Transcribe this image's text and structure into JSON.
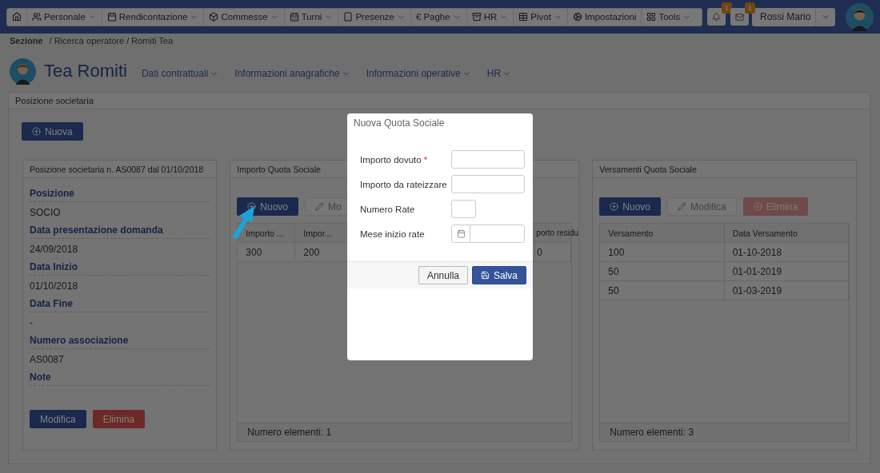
{
  "navbar": {
    "menu": [
      {
        "dropdown": false
      },
      {
        "label": "Personale",
        "dropdown": true
      },
      {
        "label": "Rendicontazione",
        "dropdown": true
      },
      {
        "label": "Commesse",
        "dropdown": true
      },
      {
        "label": "Turni",
        "dropdown": true
      },
      {
        "label": "Presenze",
        "dropdown": true
      },
      {
        "label": "Paghe",
        "symbol": "€",
        "dropdown": true
      },
      {
        "label": "HR",
        "dropdown": true
      },
      {
        "label": "Pivot",
        "dropdown": true
      },
      {
        "label": "Impostazioni",
        "dropdown": false
      },
      {
        "label": "Tools",
        "dropdown": true
      }
    ],
    "notifications": [
      {
        "badge": "1"
      },
      {
        "badge": "1"
      }
    ],
    "user": "Rossi Mario"
  },
  "breadcrumb": {
    "section": "Sezione",
    "path": "/ Ricerca operatore / Romiti Tea"
  },
  "profile": {
    "name": "Tea Romiti",
    "menus": [
      {
        "label": "Dati contrattuali"
      },
      {
        "label": "Informazioni anagrafiche"
      },
      {
        "label": "Informazioni operative"
      },
      {
        "label": "HR"
      }
    ]
  },
  "panel": {
    "title": "Posizione societaria",
    "new_button": "Nuova",
    "position_card": {
      "title": "Posizione societaria n. AS0087 dal 01/10/2018",
      "fields": [
        {
          "label": "Posizione",
          "value": "SOCIO"
        },
        {
          "label": "Data presentazione domanda",
          "value": "24/09/2018"
        },
        {
          "label": "Data Inizio",
          "value": "01/10/2018"
        },
        {
          "label": "Data Fine",
          "value": "-"
        },
        {
          "label": "Numero associazione",
          "value": "AS0087"
        },
        {
          "label": "Note"
        }
      ],
      "buttons": [
        {
          "label": "Modifica",
          "kind": "primary",
          "disabled": false
        },
        {
          "label": "Elimina",
          "kind": "danger",
          "disabled": false
        }
      ]
    },
    "amount_card": {
      "title": "Importo Quota Sociale",
      "buttons": [
        {
          "label": "Nuovo",
          "kind": "primary",
          "disabled": false
        },
        {
          "label": "Mo",
          "kind": "default",
          "disabled": true
        }
      ],
      "columns": [
        "Importo ...",
        "Impor...",
        "porto residu"
      ],
      "rows": [
        [
          "300",
          "200",
          "0"
        ]
      ],
      "footer": "Numero elementi: 1"
    },
    "payments_card": {
      "title": "Versamenti Quota Sociale",
      "buttons": [
        {
          "label": "Nuovo",
          "kind": "primary",
          "disabled": false
        },
        {
          "label": "Modifica",
          "kind": "default",
          "disabled": true
        },
        {
          "label": "Elimina",
          "kind": "danger",
          "disabled": true
        }
      ],
      "columns": [
        "Versamento",
        "Data Versamento"
      ],
      "rows": [
        [
          "100",
          "01-10-2018"
        ],
        [
          "50",
          "01-01-2019"
        ],
        [
          "50",
          "01-03-2019"
        ]
      ],
      "footer": "Numero elementi: 3"
    }
  },
  "modal": {
    "title": "Nuova Quota Sociale",
    "fields": [
      {
        "label": "Importo dovuto",
        "required_mark": "*",
        "kind": "text"
      },
      {
        "label": "Importo da rateizzare",
        "kind": "text"
      },
      {
        "label": "Numero Rate",
        "kind": "small"
      },
      {
        "label": "Mese inizio rate",
        "kind": "date"
      }
    ],
    "buttons": [
      {
        "label": "Annulla",
        "kind": "default"
      },
      {
        "label": "Salva",
        "kind": "primary"
      }
    ]
  }
}
